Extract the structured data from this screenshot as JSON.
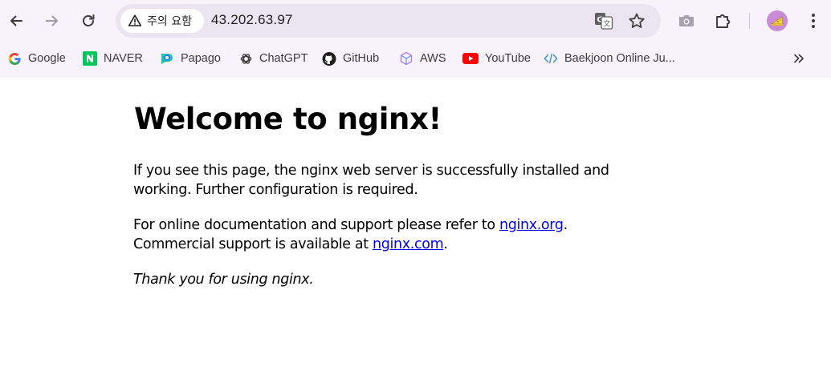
{
  "browser": {
    "security_chip": "주의 요함",
    "url": "43.202.63.97",
    "icons": {
      "back": "arrow-left-icon",
      "forward": "arrow-right-icon",
      "reload": "reload-icon",
      "translate": "translate-icon",
      "bookmark_star": "star-icon",
      "screenshot": "camera-icon",
      "extensions": "puzzle-icon",
      "menu": "kebab-menu-icon"
    },
    "accent_colors": {
      "toolbar_bg": "#f8f2fb",
      "omnibox_bg": "#ebe4f1",
      "link": "#0000ee"
    }
  },
  "bookmarks": [
    {
      "label": "Google",
      "icon": "google-icon"
    },
    {
      "label": "NAVER",
      "icon": "naver-icon"
    },
    {
      "label": "Papago",
      "icon": "papago-icon"
    },
    {
      "label": "ChatGPT",
      "icon": "chatgpt-icon"
    },
    {
      "label": "GitHub",
      "icon": "github-icon"
    },
    {
      "label": "AWS",
      "icon": "aws-icon"
    },
    {
      "label": "YouTube",
      "icon": "youtube-icon"
    },
    {
      "label": "Baekjoon Online Ju...",
      "icon": "code-icon"
    }
  ],
  "page": {
    "heading": "Welcome to nginx!",
    "p1": "If you see this page, the nginx web server is successfully installed and working. Further configuration is required.",
    "p2_pre": "For online documentation and support please refer to ",
    "p2_link1": "nginx.org",
    "p2_mid": ".",
    "p2_line2": "Commercial support is available at ",
    "p2_link2": "nginx.com",
    "p2_end": ".",
    "p3": "Thank you for using nginx."
  }
}
